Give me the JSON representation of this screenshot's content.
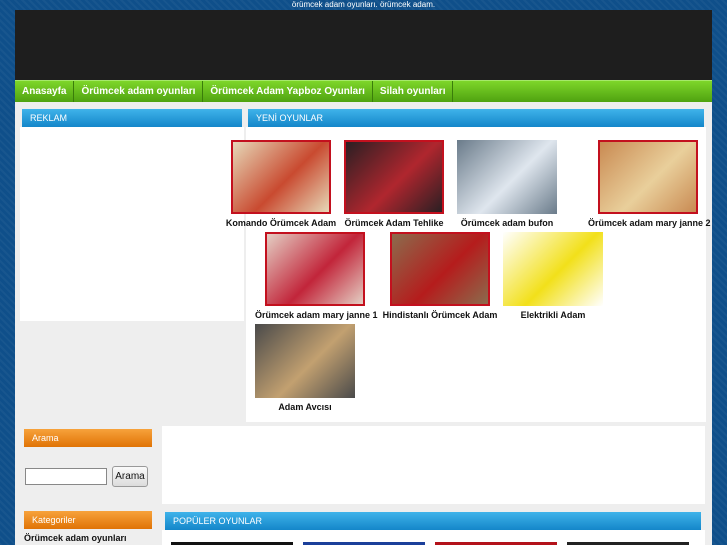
{
  "top_text": "örümcek adam oyunları. örümcek adam.",
  "nav": [
    {
      "label": "Anasayfa"
    },
    {
      "label": "Örümcek adam oyunları"
    },
    {
      "label": "Örümcek Adam Yapboz Oyunları"
    },
    {
      "label": "Silah oyunları"
    }
  ],
  "reklam": {
    "title": "REKLAM"
  },
  "new_games": {
    "title": "YENİ OYUNLAR",
    "items": [
      {
        "title": "Komando Örümcek Adam",
        "thumb_color": "#e6d8b8",
        "accent": "#c94a30"
      },
      {
        "title": "Örümcek Adam Tehlike",
        "thumb_color": "#2a1f23",
        "accent": "#b0262e"
      },
      {
        "title": "Örümcek adam bufon",
        "thumb_color": "#6a7b8a",
        "accent": "#dfe6ee"
      },
      {
        "title": "Örümcek adam mary janne 2",
        "thumb_color": "#c98a52",
        "accent": "#e9cf9b"
      },
      {
        "title": "Örümcek adam mary janne 1",
        "thumb_color": "#e4cfc4",
        "accent": "#c2253a"
      },
      {
        "title": "Hindistanlı Örümcek Adam",
        "thumb_color": "#8b6c4d",
        "accent": "#b51c1c"
      },
      {
        "title": "Elektrikli Adam",
        "thumb_color": "#ffffff",
        "accent": "#f2e01a"
      },
      {
        "title": "Adam Avcısı",
        "thumb_color": "#4a4a4a",
        "accent": "#c2a070"
      }
    ]
  },
  "search": {
    "title": "Arama",
    "button": "Arama",
    "value": ""
  },
  "categories": {
    "title": "Kategoriler",
    "first": "Örümcek adam oyunları"
  },
  "popular": {
    "title": "POPÜLER OYUNLAR"
  }
}
